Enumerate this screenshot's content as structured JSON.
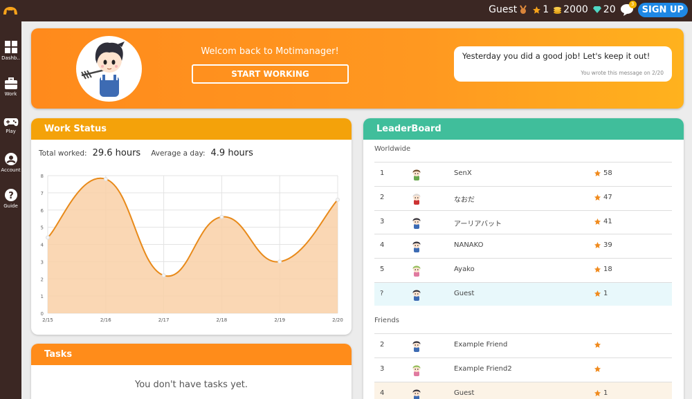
{
  "topbar": {
    "user": "Guest",
    "stars": "1",
    "coins": "2000",
    "gems": "20",
    "chat_badge": "3",
    "signup_label": "SIGN UP",
    "accent": "#1e88e5"
  },
  "sidebar": {
    "items": [
      {
        "label": "Dashb..",
        "icon": "dashboard-icon"
      },
      {
        "label": "Work",
        "icon": "briefcase-icon"
      },
      {
        "label": "Play",
        "icon": "gamepad-icon"
      },
      {
        "label": "Account",
        "icon": "account-icon"
      },
      {
        "label": "Guide",
        "icon": "help-icon"
      }
    ]
  },
  "hero": {
    "welcome": "Welcom back to Motimanager!",
    "start_button": "START WORKING",
    "message": "Yesterday you did a good job! Let's keep it out!",
    "message_note": "You wrote this message on 2/20"
  },
  "work_status": {
    "title": "Work Status",
    "total_label": "Total worked:",
    "total_value": "29.6 hours",
    "avg_label": "Average a day:",
    "avg_value": "4.9 hours"
  },
  "chart_data": {
    "type": "area",
    "x": [
      "2/15",
      "2/16",
      "2/17",
      "2/18",
      "2/19",
      "2/20"
    ],
    "values": [
      4.4,
      7.8,
      2.2,
      5.6,
      3.0,
      6.6
    ],
    "ylim": [
      0,
      8
    ],
    "yticks": [
      "0",
      "1",
      "2",
      "3",
      "4",
      "5",
      "6",
      "7",
      "8"
    ],
    "grid": true,
    "line_color": "#e88a1a",
    "fill_color": "#f9d0a7"
  },
  "tasks": {
    "title": "Tasks",
    "empty": "You don't have tasks yet."
  },
  "leaderboard": {
    "title": "LeaderBoard",
    "worldwide_label": "Worldwide",
    "worldwide": [
      {
        "rank": "1",
        "name": "SenX",
        "score": "58"
      },
      {
        "rank": "2",
        "name": "なおだ",
        "score": "47"
      },
      {
        "rank": "3",
        "name": "アーリアバット",
        "score": "41"
      },
      {
        "rank": "4",
        "name": "NANAKO",
        "score": "39"
      },
      {
        "rank": "5",
        "name": "Ayako",
        "score": "18"
      },
      {
        "rank": "?",
        "name": "Guest",
        "score": "1"
      }
    ],
    "friends_label": "Friends",
    "friends": [
      {
        "rank": "2",
        "name": "Example Friend",
        "score": ""
      },
      {
        "rank": "3",
        "name": "Example Friend2",
        "score": ""
      },
      {
        "rank": "4",
        "name": "Guest",
        "score": "1"
      }
    ],
    "star_color": "#f08a1c"
  }
}
